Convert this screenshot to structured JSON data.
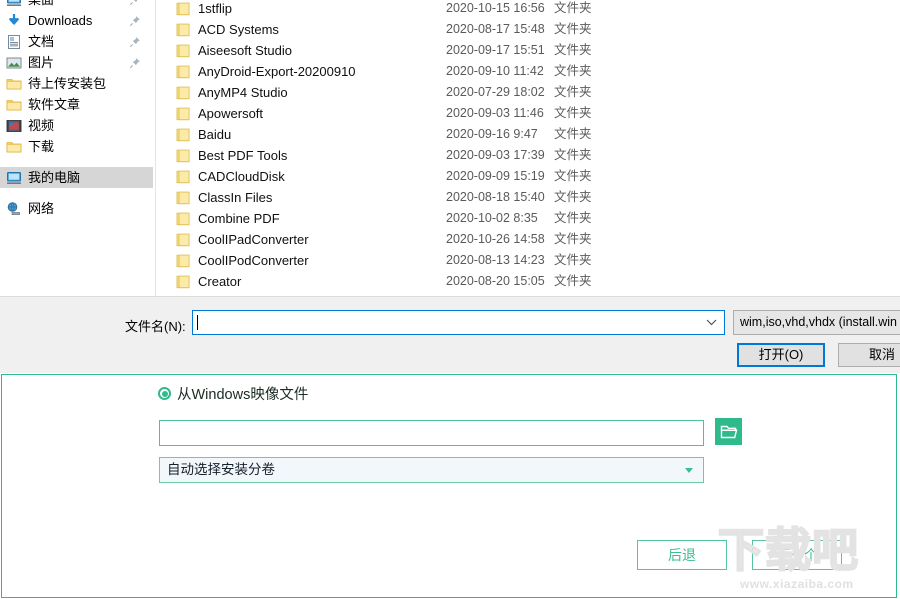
{
  "nav_pane": {
    "items": [
      {
        "label": "桌面",
        "icon": "desktop-icon",
        "pinned": true,
        "selected": false,
        "clipped": true
      },
      {
        "label": "Downloads",
        "icon": "downloads-icon",
        "pinned": true,
        "selected": false
      },
      {
        "label": "文档",
        "icon": "documents-icon",
        "pinned": true,
        "selected": false
      },
      {
        "label": "图片",
        "icon": "pictures-icon",
        "pinned": true,
        "selected": false
      },
      {
        "label": "待上传安装包",
        "icon": "folder-icon",
        "pinned": false,
        "selected": false
      },
      {
        "label": "软件文章",
        "icon": "folder-icon",
        "pinned": false,
        "selected": false
      },
      {
        "label": "视频",
        "icon": "videos-icon",
        "pinned": false,
        "selected": false
      },
      {
        "label": "下载",
        "icon": "folder-icon",
        "pinned": false,
        "selected": false
      },
      {
        "label": "我的电脑",
        "icon": "computer-icon",
        "pinned": false,
        "selected": true
      },
      {
        "label": "网络",
        "icon": "network-icon",
        "pinned": false,
        "selected": false
      }
    ]
  },
  "file_list": {
    "rows": [
      {
        "name": "1stflip",
        "date": "2020-10-15 16:56",
        "type": "文件夹"
      },
      {
        "name": "ACD Systems",
        "date": "2020-08-17 15:48",
        "type": "文件夹"
      },
      {
        "name": "Aiseesoft Studio",
        "date": "2020-09-17 15:51",
        "type": "文件夹"
      },
      {
        "name": "AnyDroid-Export-20200910",
        "date": "2020-09-10 11:42",
        "type": "文件夹"
      },
      {
        "name": "AnyMP4 Studio",
        "date": "2020-07-29 18:02",
        "type": "文件夹"
      },
      {
        "name": "Apowersoft",
        "date": "2020-09-03 11:46",
        "type": "文件夹"
      },
      {
        "name": "Baidu",
        "date": "2020-09-16 9:47",
        "type": "文件夹"
      },
      {
        "name": "Best PDF Tools",
        "date": "2020-09-03 17:39",
        "type": "文件夹"
      },
      {
        "name": "CADCloudDisk",
        "date": "2020-09-09 15:19",
        "type": "文件夹"
      },
      {
        "name": "ClassIn Files",
        "date": "2020-08-18 15:40",
        "type": "文件夹"
      },
      {
        "name": "Combine PDF",
        "date": "2020-10-02 8:35",
        "type": "文件夹"
      },
      {
        "name": "CoolIPadConverter",
        "date": "2020-10-26 14:58",
        "type": "文件夹"
      },
      {
        "name": "CoolIPodConverter",
        "date": "2020-08-13 14:23",
        "type": "文件夹"
      },
      {
        "name": "Creator",
        "date": "2020-08-20 15:05",
        "type": "文件夹"
      }
    ]
  },
  "dialog_bottom": {
    "filename_label": "文件名(N):",
    "filename_value": "",
    "filename_placeholder": "",
    "filetype_value": "wim,iso,vhd,vhdx (install.win",
    "open_button": "打开(O)",
    "cancel_button": "取消"
  },
  "wizard": {
    "radio_label": "从Windows映像文件",
    "radio_selected": true,
    "image_path_value": "",
    "image_path_placeholder": "",
    "browse_icon": "folder-open-icon",
    "volume_select_value": "自动选择安装分卷",
    "back_button": "后退",
    "next_button": "下一个",
    "accent_color": "#2fba8c"
  },
  "watermark": {
    "text": "下载吧",
    "url": "www.xiazaiba.com"
  }
}
